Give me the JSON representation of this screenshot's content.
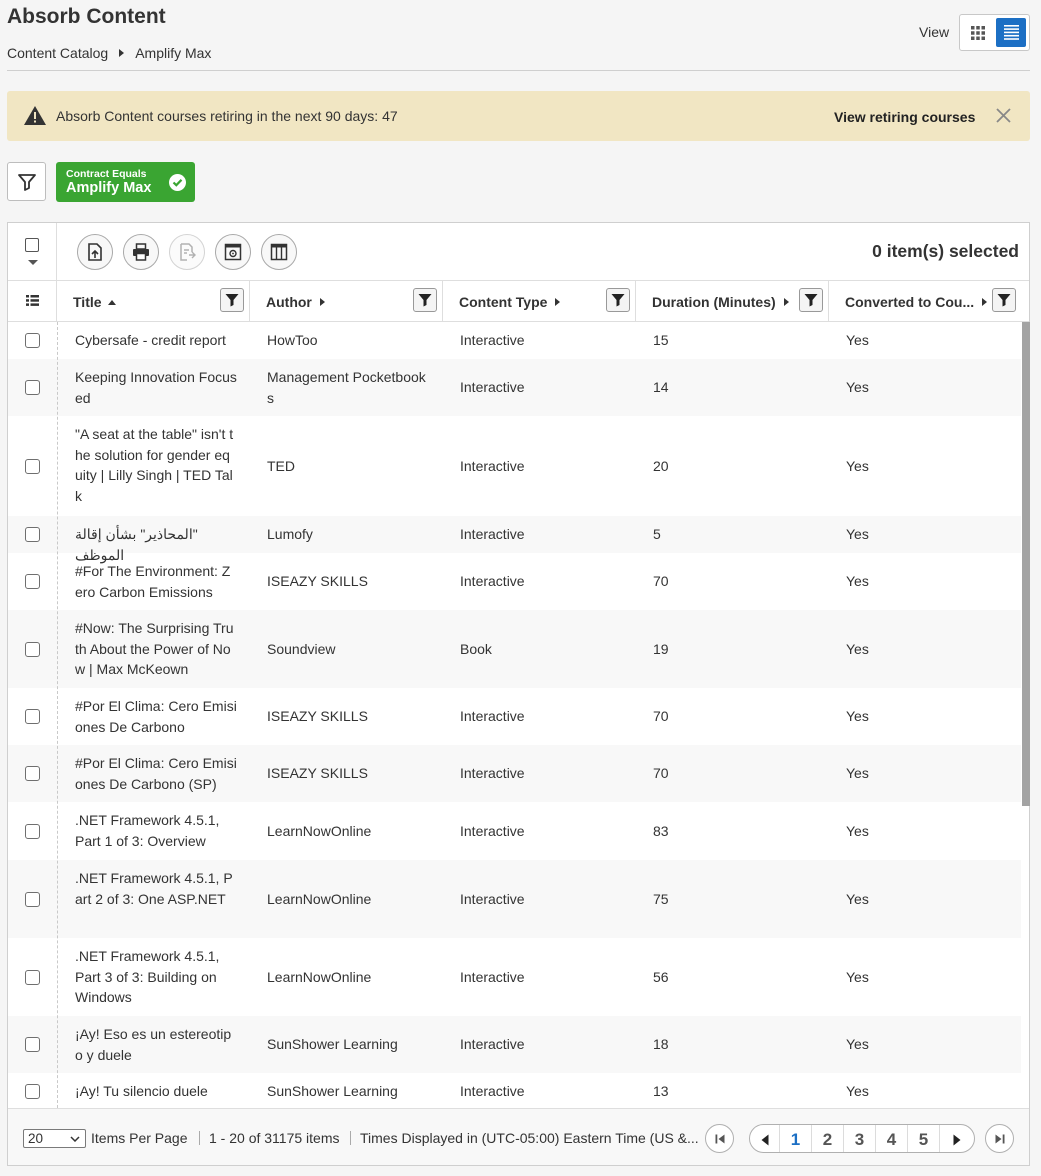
{
  "header": {
    "title": "Absorb Content",
    "breadcrumb": [
      "Content Catalog",
      "Amplify Max"
    ],
    "view_label": "View"
  },
  "banner": {
    "message": "Absorb Content courses retiring in the next 90 days: 47",
    "link": "View retiring courses"
  },
  "filter_chip": {
    "key": "Contract Equals",
    "value": "Amplify Max"
  },
  "toolbar": {
    "selected_count": "0 item(s) selected",
    "icons": [
      "export-icon",
      "print-icon",
      "assign-icon",
      "settings-panel-icon",
      "columns-icon"
    ]
  },
  "columns": [
    {
      "label": "Title",
      "sort": "asc"
    },
    {
      "label": "Author",
      "sort": "none"
    },
    {
      "label": "Content Type",
      "sort": "none"
    },
    {
      "label": "Duration (Minutes)",
      "sort": "none"
    },
    {
      "label": "Converted to Cou...",
      "sort": "none"
    }
  ],
  "rows": [
    {
      "title": "Cybersafe - credit report",
      "author": "HowToo",
      "type": "Interactive",
      "duration": "15",
      "converted": "Yes"
    },
    {
      "title": "Keeping Innovation Focused",
      "author": "Management Pocketbooks",
      "type": "Interactive",
      "duration": "14",
      "converted": "Yes"
    },
    {
      "title": "\"A seat at the table\" isn't the solution for gender equity | Lilly Singh | TED Talk",
      "author": "TED",
      "type": "Interactive",
      "duration": "20",
      "converted": "Yes"
    },
    {
      "title": "\"المحاذير\" بشأن إقالة الموظف",
      "author": "Lumofy",
      "type": "Interactive",
      "duration": "5",
      "converted": "Yes"
    },
    {
      "title": "#For The Environment: Zero Carbon Emissions",
      "author": "ISEAZY SKILLS",
      "type": "Interactive",
      "duration": "70",
      "converted": "Yes"
    },
    {
      "title": "#Now: The Surprising Truth About the Power of Now | Max McKeown",
      "author": "Soundview",
      "type": "Book",
      "duration": "19",
      "converted": "Yes"
    },
    {
      "title": "#Por El Clima: Cero Emisiones De Carbono",
      "author": "ISEAZY SKILLS",
      "type": "Interactive",
      "duration": "70",
      "converted": "Yes"
    },
    {
      "title": "#Por El Clima: Cero Emisiones De Carbono (SP)",
      "author": "ISEAZY SKILLS",
      "type": "Interactive",
      "duration": "70",
      "converted": "Yes"
    },
    {
      "title": ".NET Framework 4.5.1, Part 1 of 3: Overview",
      "author": "LearnNowOnline",
      "type": "Interactive",
      "duration": "83",
      "converted": "Yes"
    },
    {
      "title": ".NET Framework 4.5.1, Part 2 of 3: One ASP.NET",
      "author": "LearnNowOnline",
      "type": "Interactive",
      "duration": "75",
      "converted": "Yes"
    },
    {
      "title": ".NET Framework 4.5.1, Part 3 of 3: Building on Windows",
      "author": "LearnNowOnline",
      "type": "Interactive",
      "duration": "56",
      "converted": "Yes"
    },
    {
      "title": "¡Ay! Eso es un estereotipo y duele",
      "author": "SunShower Learning",
      "type": "Interactive",
      "duration": "18",
      "converted": "Yes"
    },
    {
      "title": "¡Ay! Tu silencio duele",
      "author": "SunShower Learning",
      "type": "Interactive",
      "duration": "13",
      "converted": "Yes"
    }
  ],
  "footer": {
    "per_page": "20",
    "per_page_label": "Items Per Page",
    "range": "1 - 20 of 31175 items",
    "timezone": "Times Displayed in (UTC-05:00) Eastern Time (US &...",
    "pages": [
      "1",
      "2",
      "3",
      "4",
      "5"
    ],
    "current_page": "1"
  }
}
